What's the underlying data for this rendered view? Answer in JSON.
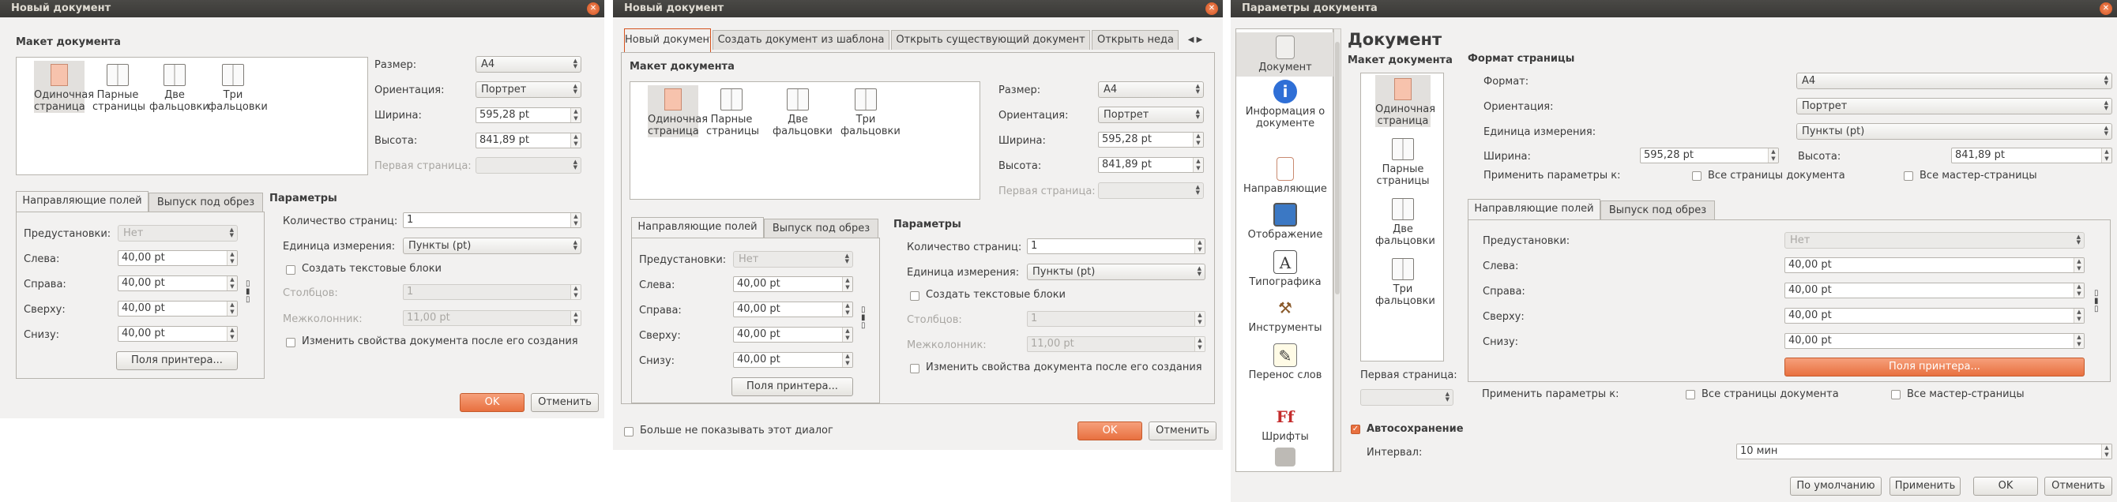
{
  "w1": {
    "title": "Новый документ",
    "layout_header": "Макет документа",
    "layouts": [
      "Одиночная страница",
      "Парные страницы",
      "Две фальцовки",
      "Три фальцовки"
    ],
    "size_label": "Размер:",
    "size_value": "A4",
    "orient_label": "Ориентация:",
    "orient_value": "Портрет",
    "width_label": "Ширина:",
    "width_value": "595,28  pt",
    "height_label": "Высота:",
    "height_value": "841,89  pt",
    "first_page_label": "Первая страница:",
    "tab_margins": "Направляющие полей",
    "tab_bleed": "Выпуск под обрез",
    "presets_label": "Предустановки:",
    "presets_value": "Нет",
    "left_label": "Слева:",
    "left_value": "40,00  pt",
    "right_label": "Справа:",
    "right_value": "40,00  pt",
    "top_label": "Сверху:",
    "top_value": "40,00  pt",
    "bottom_label": "Снизу:",
    "bottom_value": "40,00  pt",
    "printer_button": "Поля принтера...",
    "params_header": "Параметры",
    "pages_label": "Количество страниц:",
    "pages_value": "1",
    "unit_label": "Единица измерения:",
    "unit_value": "Пункты (pt)",
    "textframes_label": "Создать текстовые блоки",
    "columns_label": "Столбцов:",
    "columns_value": "1",
    "gap_label": "Межколонник:",
    "gap_value": "11,00  pt",
    "change_props_label": "Изменить свойства документа после его создания",
    "ok": "OK",
    "cancel": "Отменить"
  },
  "w2": {
    "title": "Новый документ",
    "tabs": [
      "Новый документ",
      "Создать документ из шаблона",
      "Открыть существующий документ",
      "Открыть неда"
    ],
    "dont_show": "Больше не показывать этот диалог"
  },
  "w3": {
    "title": "Параметры документа",
    "sidebar": [
      "Документ",
      "Информация о документе",
      "Направляющие",
      "Отображение",
      "Типографика",
      "Инструменты",
      "Перенос слов",
      "Шрифты"
    ],
    "heading": "Документ",
    "layout_header": "Макет документа",
    "page_format_header": "Формат страницы",
    "format_label": "Формат:",
    "format_value": "A4",
    "orient_label": "Ориентация:",
    "orient_value": "Портрет",
    "unit_label": "Единица измерения:",
    "unit_value": "Пункты (pt)",
    "width_label": "Ширина:",
    "width_value": "595,28  pt",
    "height_label": "Высота:",
    "height_value": "841,89  pt",
    "apply_label": "Применить параметры к:",
    "all_pages": "Все страницы документа",
    "all_masters": "Все мастер-страницы",
    "first_page_label": "Первая страница:",
    "autosave_label": "Автосохранение",
    "interval_label": "Интервал:",
    "interval_value": "10 мин",
    "defaults_button": "По умолчанию",
    "apply_button": "Применить",
    "ok": "OK",
    "cancel": "Отменить"
  }
}
